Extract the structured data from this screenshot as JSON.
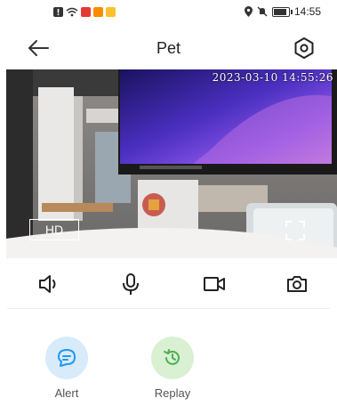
{
  "status_bar": {
    "time": "14:55",
    "left_icons": [
      "alert-icon",
      "wifi-icon",
      "app-icon-red",
      "app-icon-orange",
      "app-icon-yellow"
    ],
    "right_icons": [
      "location-icon",
      "mute-icon",
      "battery-icon"
    ],
    "battery_level": 0.8
  },
  "header": {
    "title": "Pet"
  },
  "video": {
    "timestamp": "2023-03-10 14:55:26",
    "quality_label": "HD"
  },
  "controls": {
    "items": [
      "speaker-icon",
      "microphone-icon",
      "record-video-icon",
      "snapshot-icon"
    ]
  },
  "features": {
    "alert_label": "Alert",
    "replay_label": "Replay"
  },
  "colors": {
    "accent_blue": "#2196f3",
    "alert_bg": "#d7ebfa",
    "replay_bg": "#d9f0d3",
    "replay_icon": "#4caf50"
  }
}
